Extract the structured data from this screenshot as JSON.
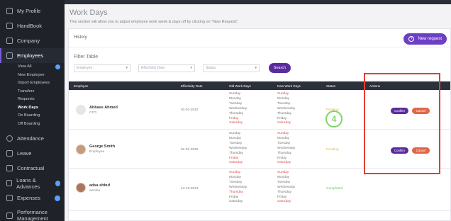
{
  "sidebar": {
    "items": [
      {
        "label": "My Profile",
        "icon": "user-icon"
      },
      {
        "label": "HandBook",
        "icon": "book-icon"
      },
      {
        "label": "Company",
        "icon": "link-icon"
      },
      {
        "label": "Employees",
        "icon": "users-icon"
      },
      {
        "label": "Attendance",
        "icon": "clock-icon"
      },
      {
        "label": "Leave",
        "icon": "user-minus-icon"
      },
      {
        "label": "Contractual",
        "icon": "file-icon"
      },
      {
        "label": "Loans & Advances",
        "icon": "wallet-icon"
      },
      {
        "label": "Expenses",
        "icon": "receipt-icon"
      },
      {
        "label": "Performance Management",
        "icon": "chart-icon"
      }
    ],
    "employee_sub": [
      "View All",
      "New Employee",
      "Import Employees",
      "Transfers",
      "Requests",
      "Work Days",
      "On Boarding",
      "Off Boarding"
    ]
  },
  "page": {
    "title": "Work Days",
    "description": "This section will allow you to adjust employee work week & days off by clicking on \"New Request\"."
  },
  "card": {
    "history": "History",
    "new_request": "New request",
    "filter_title": "Filter Table",
    "filters": {
      "employee": "Employee",
      "effectivity_date": "Effectivity Date",
      "status": "Status"
    },
    "search": "Search"
  },
  "table": {
    "headers": [
      "Employee",
      "Effectivity Date",
      "Old Work Days",
      "New Work Days",
      "Status",
      "Actions"
    ],
    "rows": [
      {
        "name": "Abbass Ahmed",
        "role": "CFO",
        "date": "01-01-2022",
        "old_days": [
          "Sunday",
          "Monday",
          "Tuesday",
          "Wednesday",
          "Thursday",
          "Friday",
          "Saturday"
        ],
        "new_days": [
          "Sunday",
          "Monday",
          "Tuesday",
          "Wednesday",
          "Thursday",
          "Friday",
          "Saturday"
        ],
        "status": "Pending",
        "confirm": "Confirm",
        "cancel": "Cancel"
      },
      {
        "name": "George Smith",
        "role": "Employee",
        "date": "01-01-2022",
        "old_days": [
          "Sunday",
          "Monday",
          "Tuesday",
          "Wednesday",
          "Thursday",
          "Friday",
          "Saturday"
        ],
        "new_days": [
          "Sunday",
          "Monday",
          "Tuesday",
          "Wednesday",
          "Thursday",
          "Friday",
          "Saturday"
        ],
        "status": "Pending",
        "confirm": "Confirm",
        "cancel": "Cancel"
      },
      {
        "name": "adsa shbuf",
        "role": "awnfsa",
        "date": "14-10-2021",
        "old_days": [
          "Sunday",
          "Monday",
          "Tuesday",
          "Wednesday",
          "Thursday",
          "Friday",
          "Saturday"
        ],
        "new_days": [
          "Sunday",
          "Monday",
          "Tuesday",
          "Wednesday",
          "Thursday",
          "Friday",
          "Saturday"
        ],
        "status": "Completed"
      }
    ]
  },
  "annotation": {
    "step_number": "4"
  },
  "colors": {
    "sidebar_bg": "#1f2329",
    "accent_purple": "#5a2ca0",
    "cancel_orange": "#e0674a",
    "pending_yellow": "#e4b63b",
    "completed_green": "#6cbf6c",
    "day_off_red": "#d9534f",
    "annotation_red": "#e43e2f",
    "annotation_green": "#7ed36a"
  }
}
